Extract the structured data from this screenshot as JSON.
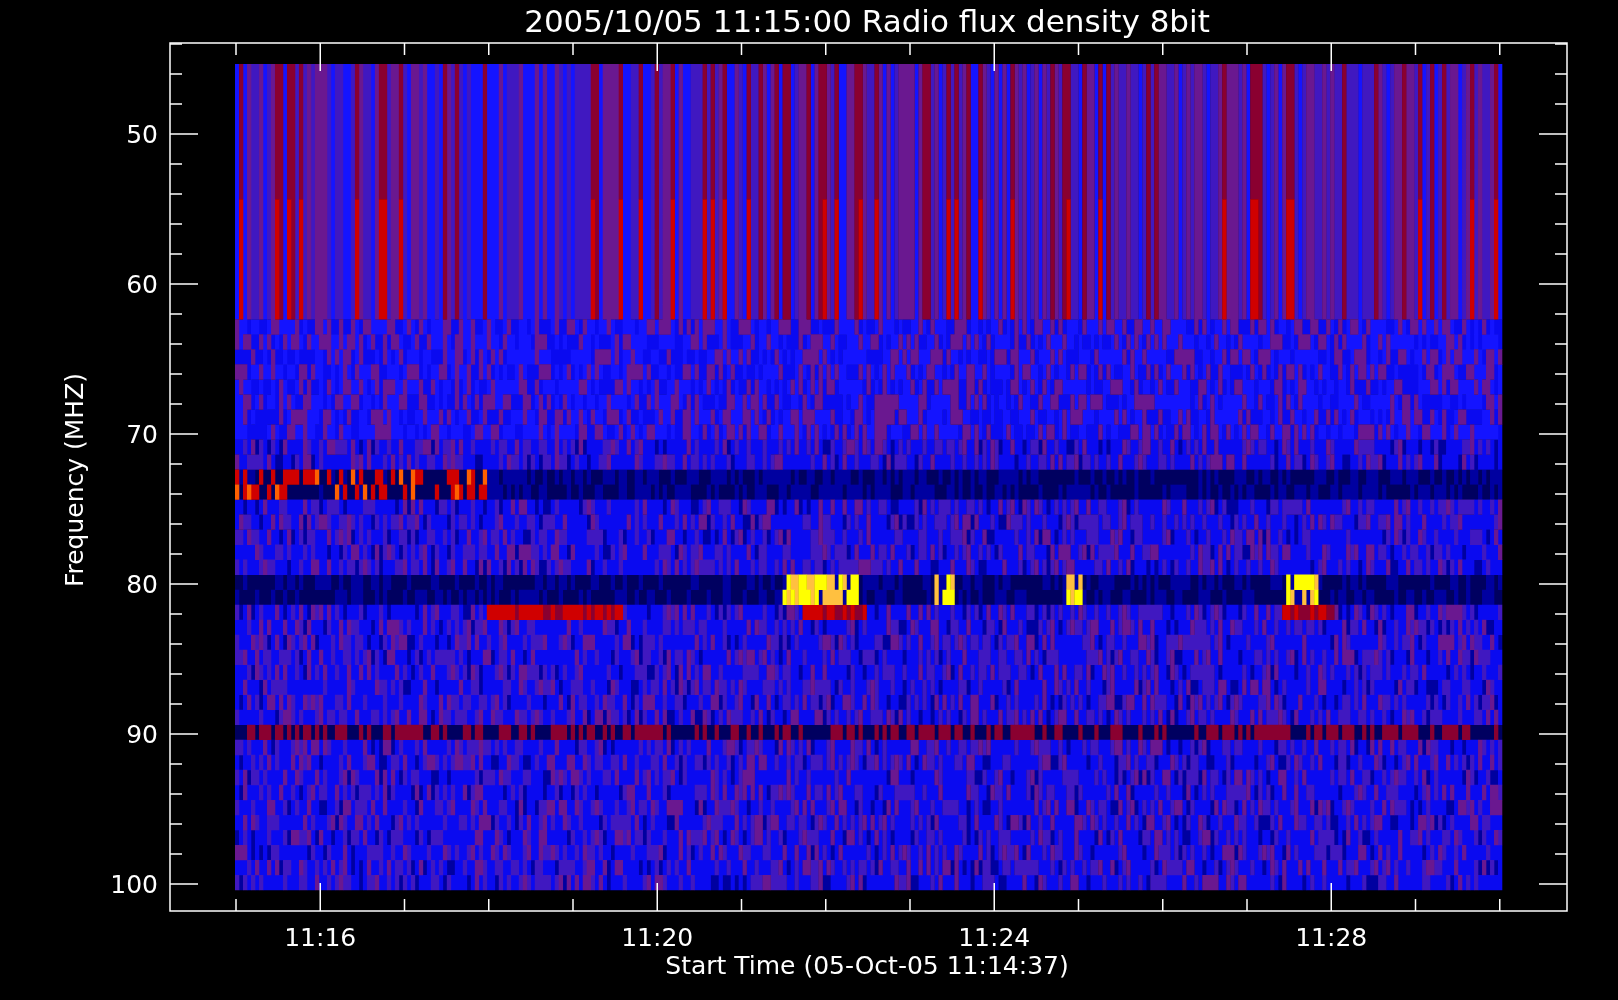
{
  "title": "2005/10/05 11:15:00 Radio flux density 8bit",
  "y_axis": {
    "label": "Frequency (MHZ)",
    "tick_labels": [
      "50",
      "60",
      "70",
      "80",
      "90",
      "100"
    ]
  },
  "x_axis": {
    "label": "Start Time (05-Oct-05 11:14:37)",
    "tick_labels": [
      "11:16",
      "11:20",
      "11:24",
      "11:28"
    ]
  }
}
